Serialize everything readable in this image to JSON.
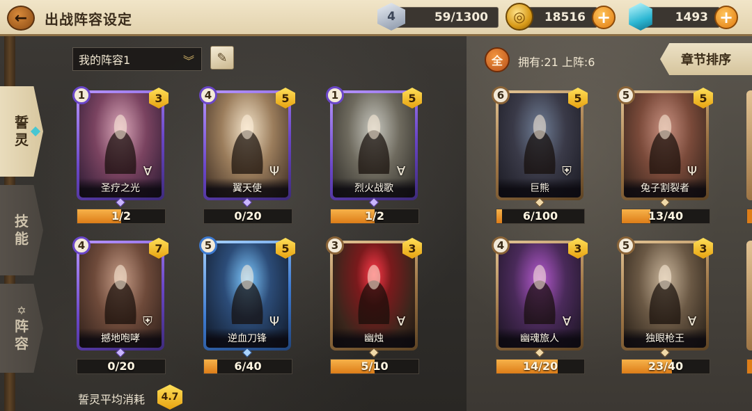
{
  "header": {
    "back_icon": "back-arrow-icon",
    "title": "出战阵容设定",
    "stamina": {
      "level": "4",
      "value": "59/1300"
    },
    "gold": {
      "value": "18516"
    },
    "gems": {
      "value": "1493"
    },
    "plus_label": "+"
  },
  "side_tabs": [
    {
      "label_1": "誓",
      "label_2": "灵",
      "active": true
    },
    {
      "label_1": "技",
      "label_2": "能",
      "active": false
    },
    {
      "label_1": "阵",
      "label_2": "容",
      "active": false,
      "icon": "crest-icon"
    }
  ],
  "lineup": {
    "selected": "我的阵容1",
    "chevron": "︾"
  },
  "collection": {
    "all_label": "全",
    "owned_text": "拥有:21 上阵:6",
    "sort_label": "章节排序"
  },
  "deck_cards": [
    {
      "name": "圣疗之光",
      "cost": "1",
      "stars": "3",
      "rarity": "purple",
      "class_icon": "bow-icon",
      "progress_text": "1/2",
      "progress": 0.5
    },
    {
      "name": "翼天使",
      "cost": "4",
      "stars": "5",
      "rarity": "purple",
      "class_icon": "trident-icon",
      "progress_text": "0/20",
      "progress": 0
    },
    {
      "name": "烈火战歌",
      "cost": "1",
      "stars": "5",
      "rarity": "purple",
      "class_icon": "bow-icon",
      "progress_text": "1/2",
      "progress": 0.5
    },
    {
      "name": "撼地咆哮",
      "cost": "4",
      "stars": "7",
      "rarity": "purple",
      "class_icon": "helmet-icon",
      "progress_text": "0/20",
      "progress": 0
    },
    {
      "name": "逆血刀锋",
      "cost": "5",
      "stars": "5",
      "rarity": "blue",
      "class_icon": "trident-icon",
      "progress_text": "6/40",
      "progress": 0.15
    },
    {
      "name": "幽烛",
      "cost": "3",
      "stars": "3",
      "rarity": "bronze",
      "class_icon": "bow-icon",
      "progress_text": "5/10",
      "progress": 0.5
    }
  ],
  "owned_cards": [
    {
      "name": "巨熊",
      "cost": "6",
      "stars": "5",
      "rarity": "bronze",
      "class_icon": "helmet-icon",
      "progress_text": "6/100",
      "progress": 0.06
    },
    {
      "name": "兔子割裂者",
      "cost": "5",
      "stars": "5",
      "rarity": "bronze",
      "class_icon": "trident-icon",
      "progress_text": "13/40",
      "progress": 0.325
    },
    {
      "name": "幽魂旅人",
      "cost": "4",
      "stars": "3",
      "rarity": "bronze",
      "class_icon": "bow-icon",
      "progress_text": "14/20",
      "progress": 0.7
    },
    {
      "name": "独眼枪王",
      "cost": "5",
      "stars": "3",
      "rarity": "bronze",
      "class_icon": "bow-icon",
      "progress_text": "23/40",
      "progress": 0.575
    }
  ],
  "avg_cost": {
    "label": "誓灵平均消耗",
    "value": "4.7"
  }
}
